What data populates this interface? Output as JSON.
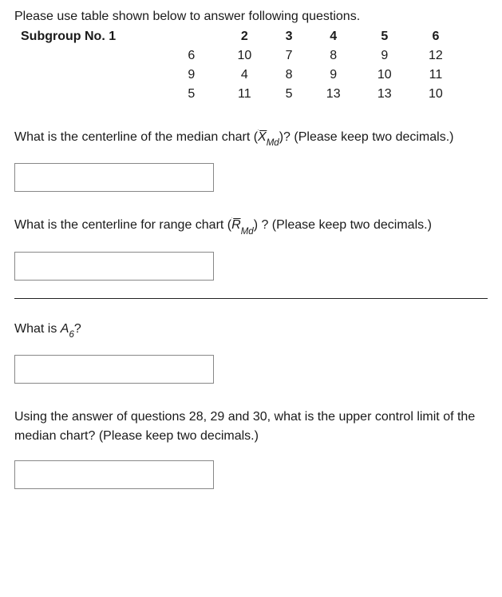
{
  "intro": "Please use table shown below to answer following questions.",
  "table": {
    "header_label": "Subgroup No. 1",
    "headers": [
      "2",
      "3",
      "4",
      "5",
      "6"
    ],
    "rows": [
      [
        "6",
        "10",
        "7",
        "8",
        "9",
        "12"
      ],
      [
        "9",
        "4",
        "8",
        "9",
        "10",
        "11"
      ],
      [
        "5",
        "11",
        "5",
        "13",
        "13",
        "10"
      ]
    ]
  },
  "q1": {
    "prefix": "What is the centerline of the median chart (",
    "symbol_main": "X̅",
    "symbol_sub": "Md",
    "suffix": ")? (Please keep two decimals.)"
  },
  "q2": {
    "prefix": "What is the centerline for range chart (",
    "symbol_main": "R̅",
    "symbol_sub": "Md",
    "suffix": ") ? (Please keep two decimals.)"
  },
  "q3": {
    "prefix": "What is ",
    "symbol_main": "A",
    "symbol_sub": "6",
    "suffix": "?"
  },
  "q4": {
    "text": "Using the answer of questions 28, 29 and 30, what is the upper control limit of the median chart? (Please keep two decimals.)"
  }
}
